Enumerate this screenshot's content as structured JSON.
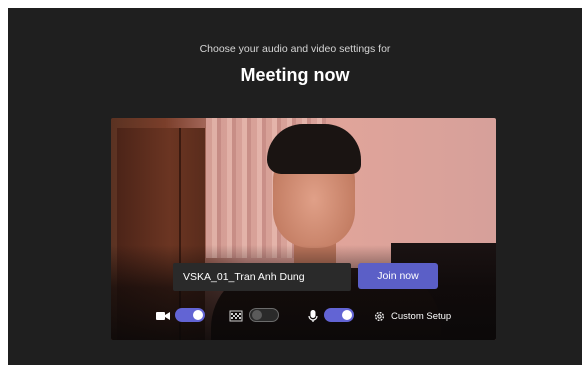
{
  "header": {
    "subtitle": "Choose your audio and video settings for",
    "title": "Meeting now"
  },
  "join": {
    "name_value": "VSKA_01_Tran Anh Dung",
    "join_label": "Join now"
  },
  "controls": {
    "camera": {
      "icon": "video-camera-icon",
      "enabled": true
    },
    "background": {
      "icon": "background-effects-icon",
      "enabled": false
    },
    "microphone": {
      "icon": "microphone-icon",
      "enabled": true
    },
    "custom_setup": {
      "icon": "gear-icon",
      "label": "Custom Setup"
    }
  },
  "colors": {
    "background": "#1f1f1f",
    "accent": "#5b5fc7",
    "toggle_on": "#6264d4"
  }
}
